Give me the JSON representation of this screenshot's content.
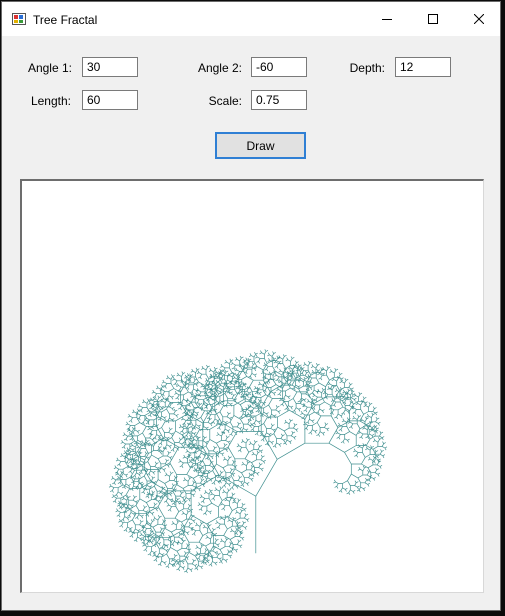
{
  "window": {
    "title": "Tree Fractal",
    "icon": "app-icon"
  },
  "form": {
    "angle1": {
      "label": "Angle 1:",
      "value": "30"
    },
    "angle2": {
      "label": "Angle 2:",
      "value": "-60"
    },
    "depth": {
      "label": "Depth:",
      "value": "12"
    },
    "length": {
      "label": "Length:",
      "value": "60"
    },
    "scale": {
      "label": "Scale:",
      "value": "0.75"
    },
    "draw_label": "Draw"
  },
  "colors": {
    "branch": "#3f8f8f",
    "draw_button_border": "#2f7fd4"
  }
}
